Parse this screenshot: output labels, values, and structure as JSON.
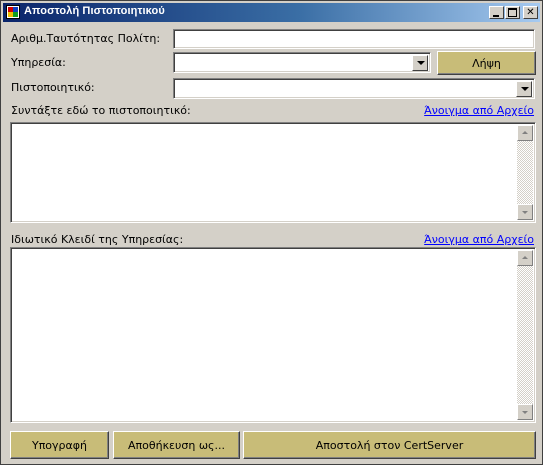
{
  "window": {
    "title": "Αποστολή Πιστοποιητικού",
    "buttons": {
      "minimize": "minimize",
      "maximize": "maximize",
      "close": "✕"
    }
  },
  "form": {
    "citizen_id": {
      "label": "Αριθμ.Ταυτότητας Πολίτη:",
      "value": ""
    },
    "service": {
      "label": "Υπηρεσία:",
      "selected": ""
    },
    "fetch_button": "Λήψη",
    "certificate": {
      "label": "Πιστοποιητικό:",
      "selected": ""
    },
    "compose": {
      "label": "Συντάξτε εδώ το πιστοποιητικό:",
      "open_link": "Άνοιγμα από Αρχείο",
      "value": ""
    },
    "private_key": {
      "label": "Ιδιωτικό Κλειδί της Υπηρεσίας:",
      "open_link": "Άνοιγμα από Αρχείο",
      "value": ""
    }
  },
  "footer": {
    "sign_button": "Υπογραφή",
    "save_as_button": "Αποθήκευση ως...",
    "send_button": "Αποστολή στον CertServer"
  },
  "colors": {
    "titlebar_start": "#0a246a",
    "titlebar_end": "#a6caf0",
    "button_face": "#c8bc78",
    "window_face": "#d4d0c8",
    "link": "#0000ff"
  }
}
